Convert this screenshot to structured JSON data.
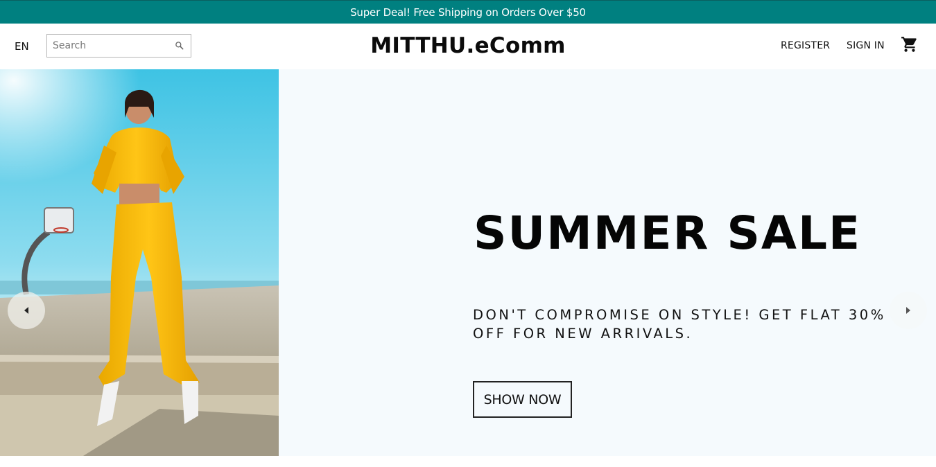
{
  "announcement": {
    "text": "Super Deal! Free Shipping on Orders Over $50",
    "background": "#008080"
  },
  "header": {
    "language": "EN",
    "search": {
      "placeholder": "Search",
      "value": ""
    },
    "logo": "MITTHU.eComm",
    "links": {
      "register": "REGISTER",
      "sign_in": "SIGN IN"
    },
    "icons": {
      "search": "search-icon",
      "cart": "shopping-cart-icon"
    }
  },
  "slider": {
    "background": "#f5fafd",
    "title": "SUMMER SALE",
    "description": "DON'T COMPROMISE ON STYLE! GET FLAT 30% OFF FOR NEW ARRIVALS.",
    "button_label": "SHOW NOW",
    "icons": {
      "prev": "arrow-left-icon",
      "next": "arrow-right-icon"
    }
  }
}
